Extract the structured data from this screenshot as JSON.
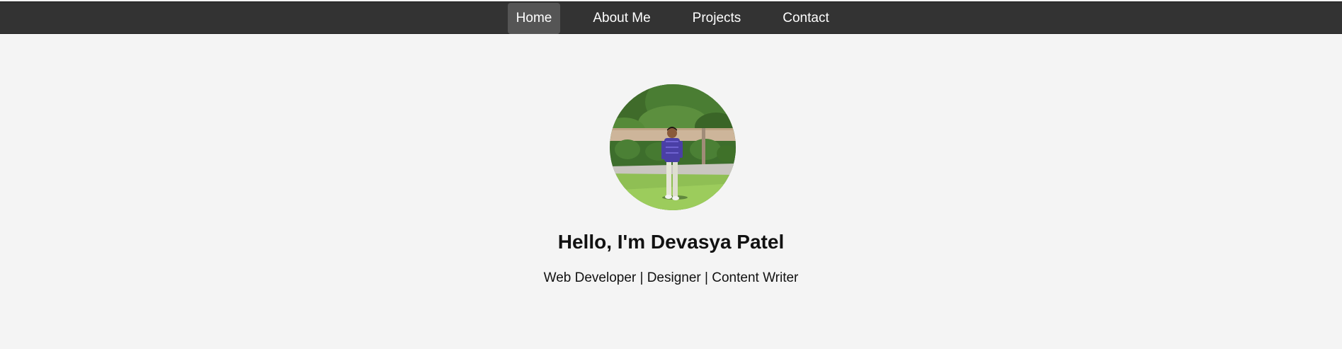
{
  "nav": {
    "items": [
      {
        "label": "Home",
        "active": true
      },
      {
        "label": "About Me",
        "active": false
      },
      {
        "label": "Projects",
        "active": false
      },
      {
        "label": "Contact",
        "active": false
      }
    ]
  },
  "hero": {
    "title": "Hello, I'm Devasya Patel",
    "subtitle": "Web Developer | Designer | Content Writer"
  },
  "colors": {
    "navbar_bg": "#333333",
    "nav_active_bg": "#555555",
    "page_bg": "#f4f4f4",
    "text": "#111111"
  }
}
